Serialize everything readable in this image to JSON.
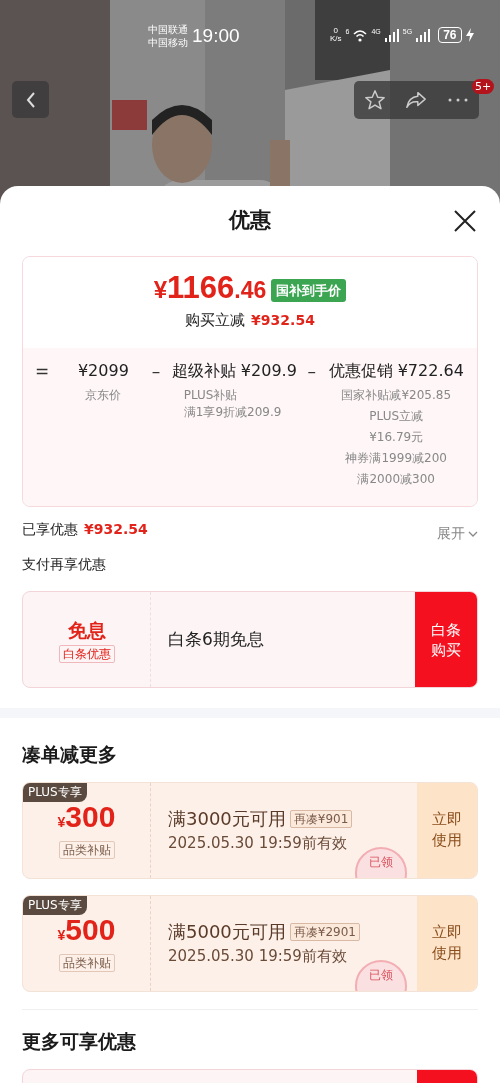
{
  "status_bar": {
    "carriers": [
      "中国联通",
      "中国移动"
    ],
    "time": "19:00",
    "net_speed": [
      "0",
      "K/s"
    ],
    "wifi_label": "6",
    "signals": [
      "4G",
      "5G"
    ],
    "battery": "76"
  },
  "nav": {
    "badge": "5+"
  },
  "sheet": {
    "title": "优惠"
  },
  "summary": {
    "currency": "¥",
    "price_integer": "1166",
    "price_decimal": ".46",
    "tag": "国补到手价",
    "reduction_label": "购买立减",
    "reduction_value": "¥932.54"
  },
  "breakdown": [
    {
      "operator": "=",
      "title": "¥2099",
      "notes": [
        "京东价"
      ]
    },
    {
      "operator": "–",
      "title": "超级补贴 ¥209.9",
      "notes": [
        "PLUS补贴",
        "满1享9折减209.9"
      ]
    },
    {
      "operator": "–",
      "title": "优惠促销 ¥722.64",
      "notes": [
        "国家补贴减¥205.85",
        "PLUS立减",
        "¥16.79元",
        "神券满1999减200",
        "满2000减300"
      ]
    }
  ],
  "enjoyed": {
    "label": "已享优惠",
    "value": "¥932.54",
    "toggle": "展开",
    "expanded": false
  },
  "pay_section": {
    "title": "支付再享优惠",
    "offer": {
      "badge_title": "免息",
      "badge_tag": "白条优惠",
      "text": "白条6期免息",
      "button": "白条购买"
    }
  },
  "coupon_section": {
    "title": "凑单减更多",
    "coupons": [
      {
        "tag": "PLUS专享",
        "currency": "¥",
        "amount": "300",
        "category": "品类补贴",
        "condition": "满3000元可用",
        "gap": "再凑¥901",
        "validity": "2025.05.30 19:59前有效",
        "button": "立即使用",
        "stamp": "已领"
      },
      {
        "tag": "PLUS专享",
        "currency": "¥",
        "amount": "500",
        "category": "品类补贴",
        "condition": "满5000元可用",
        "gap": "再凑¥2901",
        "validity": "2025.05.30 19:59前有效",
        "button": "立即使用",
        "stamp": "已领"
      }
    ]
  },
  "more_section": {
    "title": "更多可享优惠"
  }
}
